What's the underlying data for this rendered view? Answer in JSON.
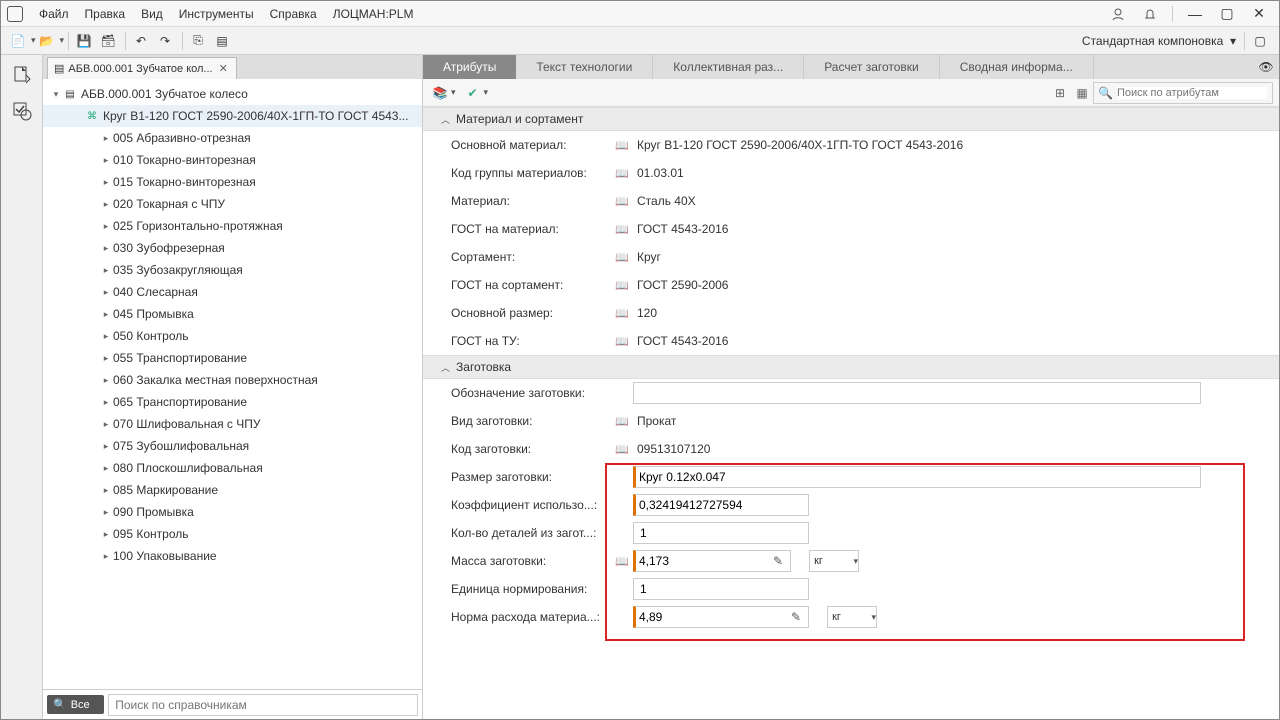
{
  "menu": {
    "items": [
      "Файл",
      "Правка",
      "Вид",
      "Инструменты",
      "Справка",
      "ЛОЦМАН:PLM"
    ]
  },
  "layout_label": "Стандартная компоновка",
  "tab": {
    "title": "АБВ.000.001 Зубчатое кол..."
  },
  "tree": {
    "root": "АБВ.000.001 Зубчатое колесо",
    "selected": "Круг В1-120 ГОСТ 2590-2006/40Х-1ГП-ТО ГОСТ 4543...",
    "ops": [
      "005 Абразивно-отрезная",
      "010 Токарно-винторезная",
      "015 Токарно-винторезная",
      "020 Токарная с ЧПУ",
      "025 Горизонтально-протяжная",
      "030 Зубофрезерная",
      "035 Зубозакругляющая",
      "040 Слесарная",
      "045 Промывка",
      "050 Контроль",
      "055 Транспортирование",
      "060 Закалка местная поверхностная",
      "065 Транспортирование",
      "070 Шлифовальная с ЧПУ",
      "075 Зубошлифовальная",
      "080 Плоскошлифовальная",
      "085 Маркирование",
      "090 Промывка",
      "095 Контроль",
      "100 Упаковывание"
    ]
  },
  "search": {
    "all": "Все",
    "placeholder": "Поиск по справочникам"
  },
  "rtabs": [
    "Атрибуты",
    "Текст технологии",
    "Коллективная раз...",
    "Расчет заготовки",
    "Сводная информа..."
  ],
  "attr_search_placeholder": "Поиск по атрибутам",
  "section1": {
    "title": "Материал и сортамент",
    "rows": [
      {
        "label": "Основной материал:",
        "value": "Круг В1-120 ГОСТ 2590-2006/40Х-1ГП-ТО ГОСТ 4543-2016",
        "book": true
      },
      {
        "label": "Код группы материалов:",
        "value": "01.03.01",
        "book": true
      },
      {
        "label": "Материал:",
        "value": "Сталь 40Х",
        "book": true
      },
      {
        "label": "ГОСТ на материал:",
        "value": "ГОСТ 4543-2016",
        "book": true
      },
      {
        "label": "Сортамент:",
        "value": "Круг",
        "book": true
      },
      {
        "label": "ГОСТ на сортамент:",
        "value": "ГОСТ 2590-2006",
        "book": true
      },
      {
        "label": "Основной размер:",
        "value": "120",
        "book": true
      },
      {
        "label": "ГОСТ на ТУ:",
        "value": "ГОСТ 4543-2016",
        "book": true
      }
    ]
  },
  "section2": {
    "title": "Заготовка",
    "designation_label": "Обозначение заготовки:",
    "designation_value": "",
    "type_label": "Вид заготовки:",
    "type_value": "Прокат",
    "code_label": "Код заготовки:",
    "code_value": "09513107120",
    "size_label": "Размер заготовки:",
    "size_value": "Круг 0.12x0.047",
    "coef_label": "Коэффициент использо...:",
    "coef_value": "0,32419412727594",
    "count_label": "Кол-во деталей из загот...:",
    "count_value": "1",
    "mass_label": "Масса заготовки:",
    "mass_value": "4,173",
    "mass_unit": "кг",
    "norm_unit_label": "Единица нормирования:",
    "norm_unit_value": "1",
    "material_norm_label": "Норма расхода материа...:",
    "material_norm_value": "4,89",
    "material_norm_unit": "кг"
  }
}
